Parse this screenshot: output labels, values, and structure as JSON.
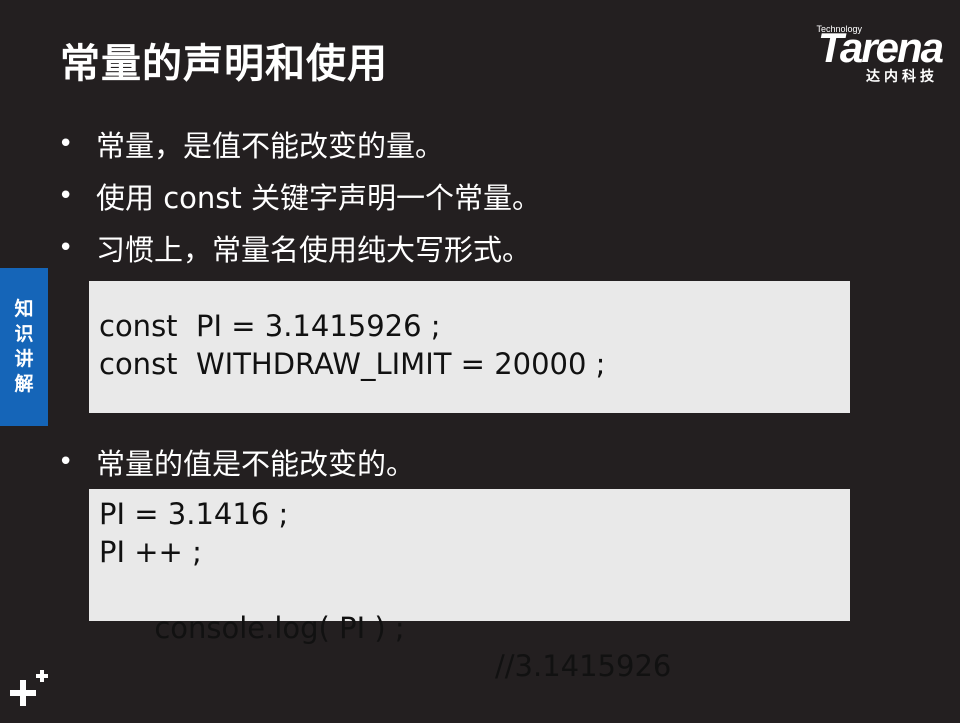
{
  "slide": {
    "title": "常量的声明和使用",
    "logo": {
      "small_text": "Technology",
      "main_text": "Tarena",
      "sub_text": "达内科技"
    },
    "side_tab": [
      "知",
      "识",
      "讲",
      "解"
    ],
    "bullets": [
      "常量，是值不能改变的量。",
      "使用 const 关键字声明一个常量。",
      "习惯上，常量名使用纯大写形式。"
    ],
    "code_block_1": [
      "const  PI = 3.1415926 ;",
      "const  WITHDRAW_LIMIT = 20000 ;"
    ],
    "bullet_2": "常量的值是不能改变的。",
    "code_block_2": {
      "lines": [
        "PI = 3.1416 ;",
        "PI ++ ;",
        "console.log( PI ) ;"
      ],
      "comment": "//3.1415926"
    },
    "bullet_char": "•",
    "colors": {
      "background": "#231f20",
      "code_background": "#e9e9e9",
      "side_tab": "#1565b8",
      "text": "#ffffff"
    },
    "icons": {
      "corner": "plus-decoration-icon"
    }
  }
}
